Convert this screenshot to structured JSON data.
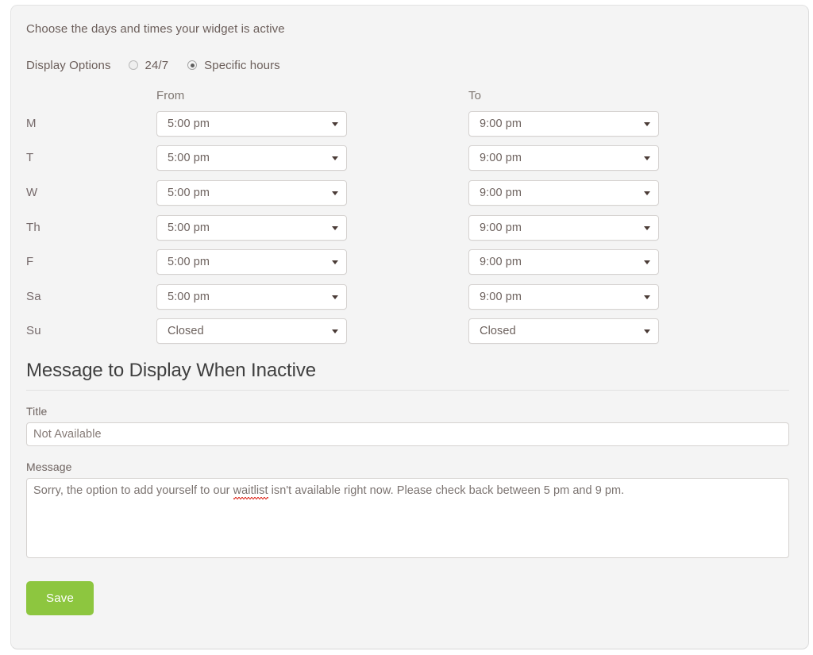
{
  "intro": "Choose the days and times your widget is active",
  "display_options": {
    "label": "Display Options",
    "options": [
      {
        "label": "24/7",
        "selected": false
      },
      {
        "label": "Specific hours",
        "selected": true
      }
    ]
  },
  "schedule": {
    "headers": {
      "day": "",
      "from": "From",
      "to": "To"
    },
    "rows": [
      {
        "day": "M",
        "from": "5:00 pm",
        "to": "9:00 pm"
      },
      {
        "day": "T",
        "from": "5:00 pm",
        "to": "9:00 pm"
      },
      {
        "day": "W",
        "from": "5:00 pm",
        "to": "9:00 pm"
      },
      {
        "day": "Th",
        "from": "5:00 pm",
        "to": "9:00 pm"
      },
      {
        "day": "F",
        "from": "5:00 pm",
        "to": "9:00 pm"
      },
      {
        "day": "Sa",
        "from": "5:00 pm",
        "to": "9:00 pm"
      },
      {
        "day": "Su",
        "from": "Closed",
        "to": "Closed"
      }
    ]
  },
  "inactive_message": {
    "section_title": "Message to Display When Inactive",
    "title_label": "Title",
    "title_value": "Not Available",
    "message_label": "Message",
    "message_parts": {
      "before": "Sorry, the option to add yourself to our ",
      "misspelled": "waitlist",
      "after": " isn't available right now. Please check back between 5 pm and 9 pm."
    }
  },
  "save_label": "Save",
  "colors": {
    "accent_green": "#8dc63f",
    "panel_bg": "#f4f4f4",
    "spellcheck_red": "#e03a2f"
  }
}
